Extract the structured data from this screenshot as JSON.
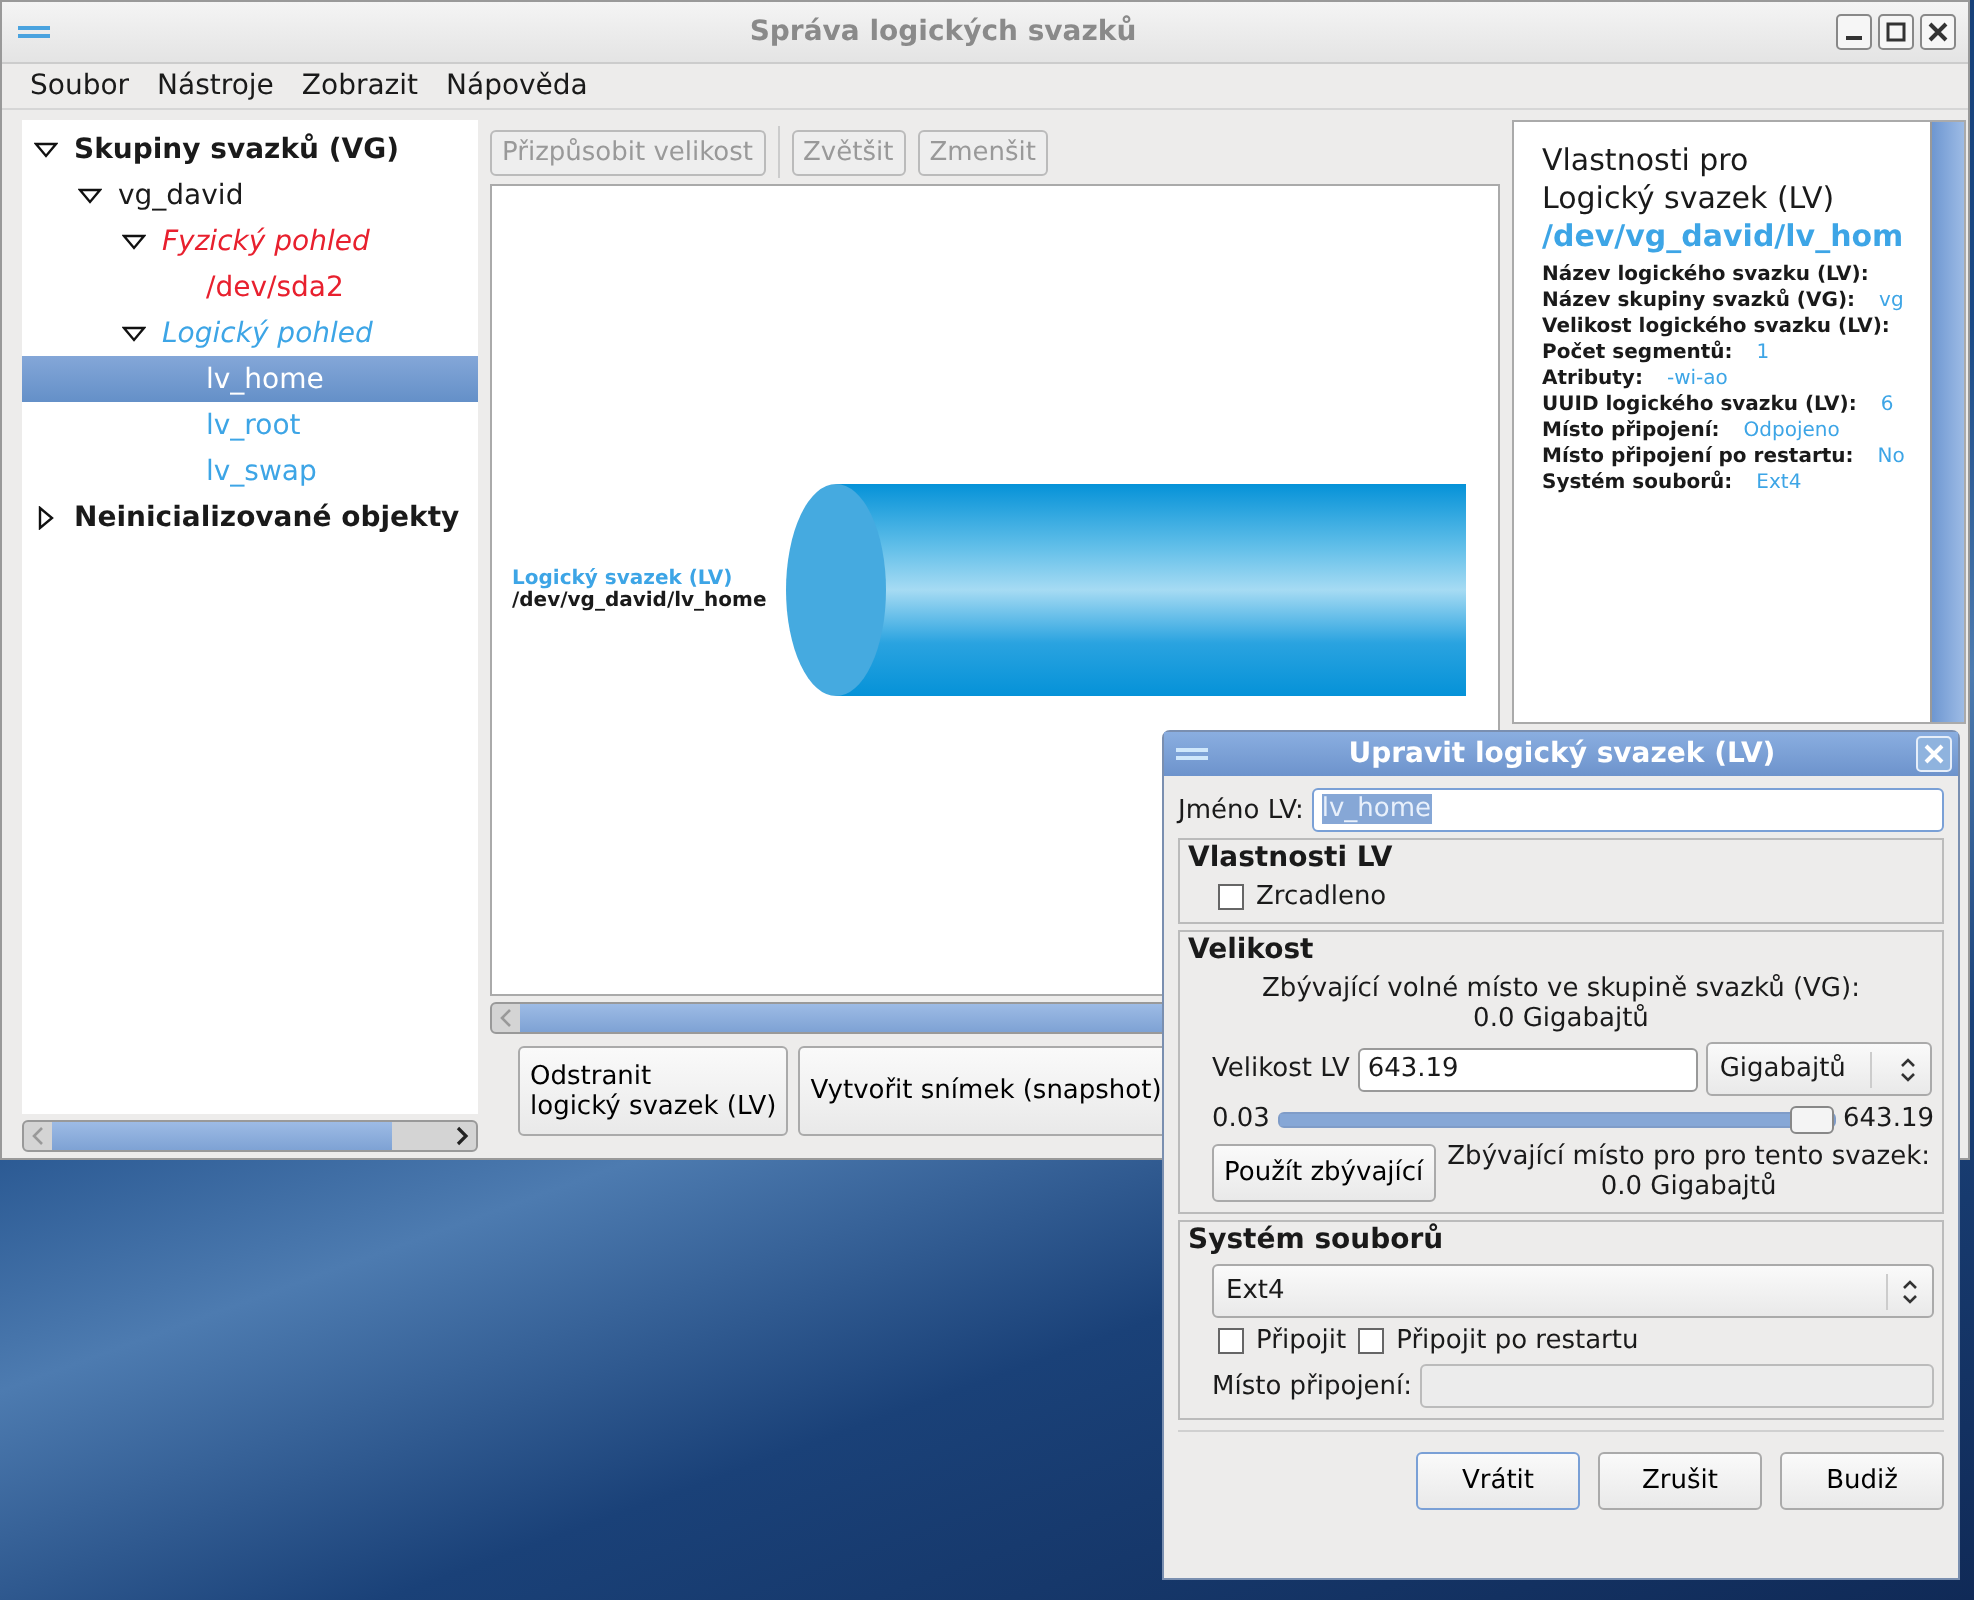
{
  "window": {
    "title": "Správa logických svazků"
  },
  "menu": [
    "Soubor",
    "Nástroje",
    "Zobrazit",
    "Nápověda"
  ],
  "tree": [
    {
      "label": "Skupiny svazků (VG)",
      "kind": "root",
      "expanded": true,
      "selected": false,
      "children": [
        {
          "label": "vg_david",
          "kind": "vg",
          "expanded": true,
          "selected": false,
          "children": [
            {
              "label": "Fyzický pohled",
              "kind": "pv-view",
              "expanded": true,
              "selected": false,
              "children": [
                {
                  "label": "/dev/sda2",
                  "kind": "pv",
                  "selected": false
                }
              ]
            },
            {
              "label": "Logický pohled",
              "kind": "lv-view",
              "expanded": true,
              "selected": false,
              "children": [
                {
                  "label": "lv_home",
                  "kind": "lv",
                  "selected": true
                },
                {
                  "label": "lv_root",
                  "kind": "lv",
                  "selected": false
                },
                {
                  "label": "lv_swap",
                  "kind": "lv",
                  "selected": false
                }
              ]
            }
          ]
        }
      ]
    },
    {
      "label": "Neinicializované objekty",
      "kind": "root",
      "expanded": false,
      "selected": false
    }
  ],
  "toolbar": [
    {
      "label": "Přizpůsobit velikost",
      "disabled": true
    },
    {
      "label": "Zvětšit",
      "disabled": true
    },
    {
      "label": "Zmenšit",
      "disabled": true
    }
  ],
  "canvas": {
    "caption": "Logický svazek (LV)",
    "path": "/dev/vg_david/lv_home"
  },
  "actions": [
    "Odstranit\nlogický svazek (LV)",
    "Vytvořit snímek (snapshot)"
  ],
  "properties": {
    "heading": "Vlastnosti pro\nLogický svazek (LV)",
    "name": "/dev/vg_david/lv_hom",
    "rows": [
      {
        "label": "Název logického svazku (LV):"
      },
      {
        "label": "Název skupiny svazků (VG):",
        "value": "vg"
      },
      {
        "label": "Velikost logického svazku (LV):"
      },
      {
        "label": "Počet segmentů:",
        "value": "1"
      },
      {
        "label": "Atributy:",
        "value": "-wi-ao"
      },
      {
        "label": "UUID logického svazku (LV):",
        "value": "6"
      },
      {
        "label": "Místo připojení:",
        "value": "Odpojeno"
      },
      {
        "label": "Místo připojení po restartu:",
        "value": "No"
      },
      {
        "label": "Systém souborů:",
        "value": "Ext4"
      }
    ]
  },
  "dialog": {
    "title": "Upravit logický svazek (LV)",
    "name_label": "Jméno LV:",
    "name_value": "lv_home",
    "lv_properties": {
      "title": "Vlastnosti LV",
      "mirrored": {
        "label": "Zrcadleno",
        "checked": false
      }
    },
    "size": {
      "title": "Velikost",
      "free_vg": "Zbývající volné místo ve skupině svazků (VG):\n0.0 Gigabajtů",
      "size_label": "Velikost LV",
      "size_value": "643.19",
      "unit": "Gigabajtů",
      "min": "0.03",
      "max": "643.19",
      "level": 1,
      "use_remaining": "Použít zbývající",
      "free_lv": "Zbývající místo pro pro tento svazek:\n0.0 Gigabajtů"
    },
    "filesystem": {
      "title": "Systém souborů",
      "type": "Ext4",
      "mount": {
        "label": "Připojit",
        "checked": false
      },
      "mount_reboot": {
        "label": "Připojit po restartu",
        "checked": false
      },
      "mountpoint_label": "Místo připojení:"
    },
    "buttons": [
      "Vrátit",
      "Zrušit",
      "Budiž"
    ]
  }
}
